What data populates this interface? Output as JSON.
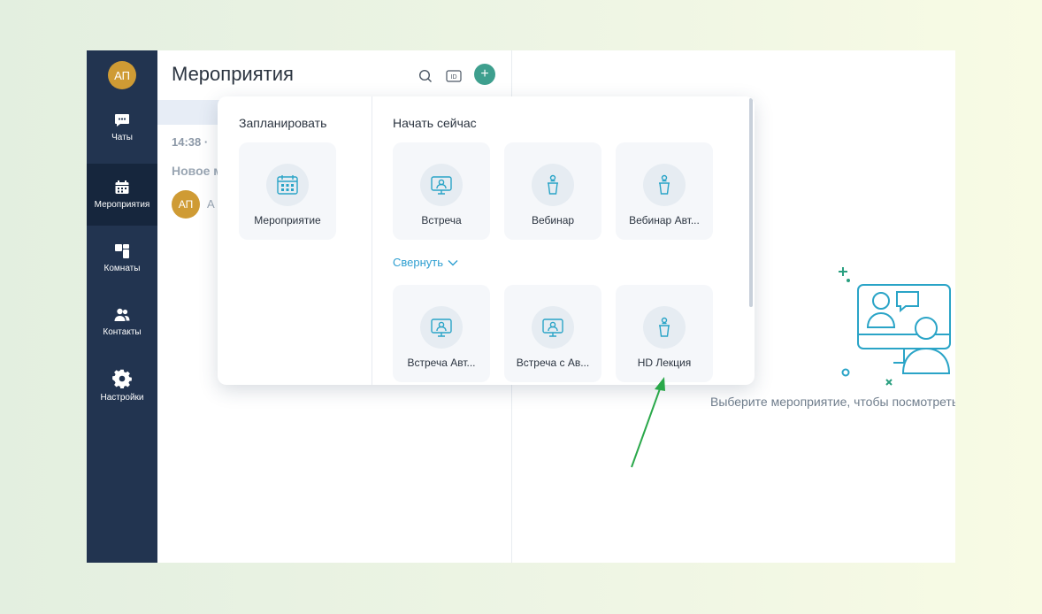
{
  "sidebar": {
    "avatar_initials": "АП",
    "items": [
      {
        "label": "Чаты",
        "icon": "chat-icon"
      },
      {
        "label": "Мероприятия",
        "icon": "calendar-icon"
      },
      {
        "label": "Комнаты",
        "icon": "rooms-icon"
      },
      {
        "label": "Контакты",
        "icon": "contacts-icon"
      },
      {
        "label": "Настройки",
        "icon": "gear-icon"
      }
    ],
    "active": "Мероприятия"
  },
  "list": {
    "title": "Мероприятия",
    "tools": [
      "search-icon",
      "id-icon",
      "plus-icon"
    ],
    "event": {
      "time": "14:38 ·",
      "title": "Новое м",
      "avatar": "АП",
      "avatar_text": "А"
    }
  },
  "popup": {
    "schedule_title": "Запланировать",
    "schedule_cards": [
      {
        "label": "Мероприятие",
        "icon": "calendar-icon"
      }
    ],
    "start_title": "Начать сейчас",
    "start_cards": [
      {
        "label": "Встреча",
        "icon": "monitor-person-icon"
      },
      {
        "label": "Вебинар",
        "icon": "podium-icon"
      },
      {
        "label": "Вебинар Авт...",
        "icon": "podium-icon"
      },
      {
        "label": "Встреча Авт...",
        "icon": "monitor-person-icon"
      },
      {
        "label": "Встреча с Ав...",
        "icon": "monitor-person-icon"
      },
      {
        "label": "HD Лекция",
        "icon": "podium-icon"
      }
    ],
    "collapse_label": "Свернуть"
  },
  "empty_state": {
    "text": "Выберите мероприятие, чтобы посмотреть"
  },
  "colors": {
    "sidebar": "#223450",
    "accent": "#3e9f8e",
    "link": "#2f9fd1",
    "illustration": "#2aa4c7",
    "arrow": "#2aa84a"
  }
}
